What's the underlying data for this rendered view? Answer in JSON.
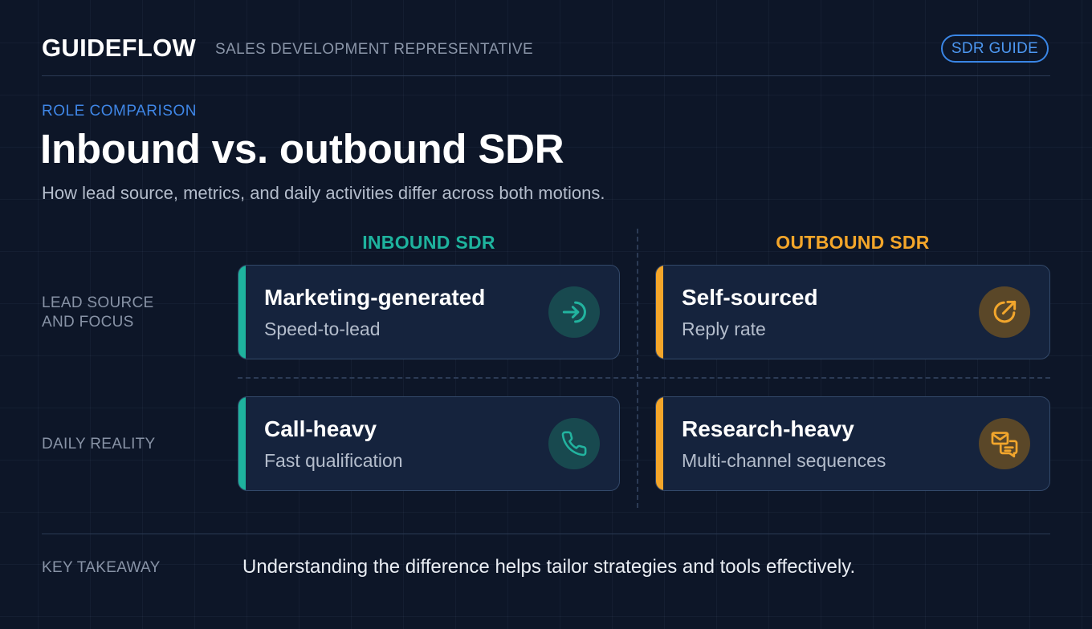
{
  "header": {
    "brand": "GUIDEFLOW",
    "brand_subtitle": "SALES DEVELOPMENT REPRESENTATIVE",
    "badge": "SDR GUIDE"
  },
  "intro": {
    "eyebrow": "ROLE COMPARISON",
    "title": "Inbound vs. outbound SDR",
    "subtitle": "How lead source, metrics, and daily activities differ across both motions."
  },
  "columns": {
    "inbound": "INBOUND SDR",
    "outbound": "OUTBOUND SDR"
  },
  "rows": {
    "lead_source": {
      "label_line1": "LEAD SOURCE",
      "label_line2": "AND FOCUS",
      "inbound": {
        "title": "Marketing-generated",
        "subtitle": "Speed-to-lead",
        "icon": "arrow-into-circle-icon"
      },
      "outbound": {
        "title": "Self-sourced",
        "subtitle": "Reply rate",
        "icon": "arrow-out-circle-icon"
      }
    },
    "daily_reality": {
      "label": "DAILY REALITY",
      "inbound": {
        "title": "Call-heavy",
        "subtitle": "Fast qualification",
        "icon": "phone-icon"
      },
      "outbound": {
        "title": "Research-heavy",
        "subtitle": "Multi-channel sequences",
        "icon": "messages-icon"
      }
    }
  },
  "footer": {
    "label": "KEY TAKEAWAY",
    "text": "Understanding the difference helps tailor strategies and tools effectively."
  },
  "colors": {
    "background": "#0d1628",
    "inbound_accent": "#1eb39e",
    "outbound_accent": "#f4a62a",
    "badge_blue": "#3a86e6",
    "card_bg": "#15233d"
  }
}
